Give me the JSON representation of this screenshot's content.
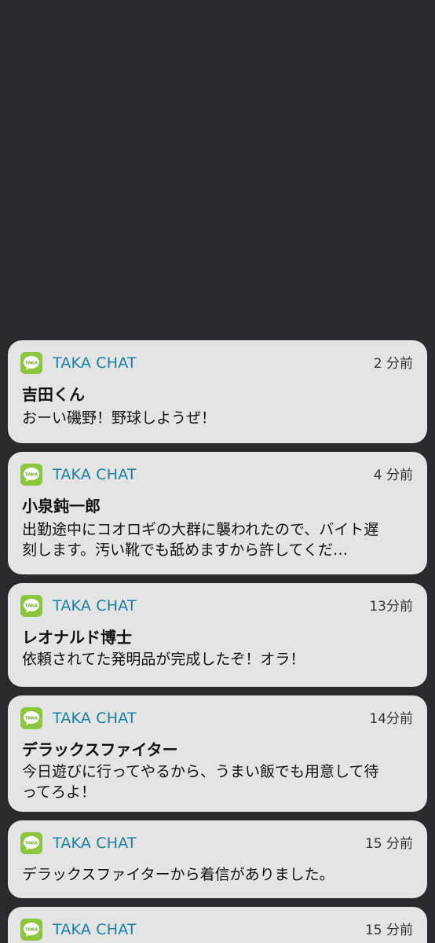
{
  "app": {
    "icon_name": "taka-chat-app-icon",
    "icon_label": "TAKA",
    "accent_color": "#8cc63f",
    "name_color": "#1a7fa3"
  },
  "notifications": [
    {
      "app_name": "TAKA CHAT",
      "time": "2 分前",
      "sender": "吉田くん",
      "message_lines": [
        "おーい磯野！野球しようぜ！"
      ]
    },
    {
      "app_name": "TAKA CHAT",
      "time": "4 分前",
      "sender": "小泉鈍一郎",
      "message_lines": [
        "出勤途中にコオロギの大群に襲われたので、バイト遅",
        "刻します。汚い靴でも舐めますから許してくだ…"
      ]
    },
    {
      "app_name": "TAKA CHAT",
      "time": "13分前",
      "sender": "レオナルド博士",
      "message_lines": [
        "依頼されてた発明品が完成したぞ！オラ！"
      ]
    },
    {
      "app_name": "TAKA CHAT",
      "time": "14分前",
      "sender": "デラックスファイター",
      "message_lines": [
        "今日遊びに行ってやるから、うまい飯でも用意して待",
        "ってろよ！"
      ]
    },
    {
      "app_name": "TAKA CHAT",
      "time": "15 分前",
      "sender": "",
      "message_lines": [
        "デラックスファイターから着信がありました。"
      ]
    },
    {
      "app_name": "TAKA CHAT",
      "time": "15 分前",
      "sender": "",
      "message_lines": []
    }
  ]
}
